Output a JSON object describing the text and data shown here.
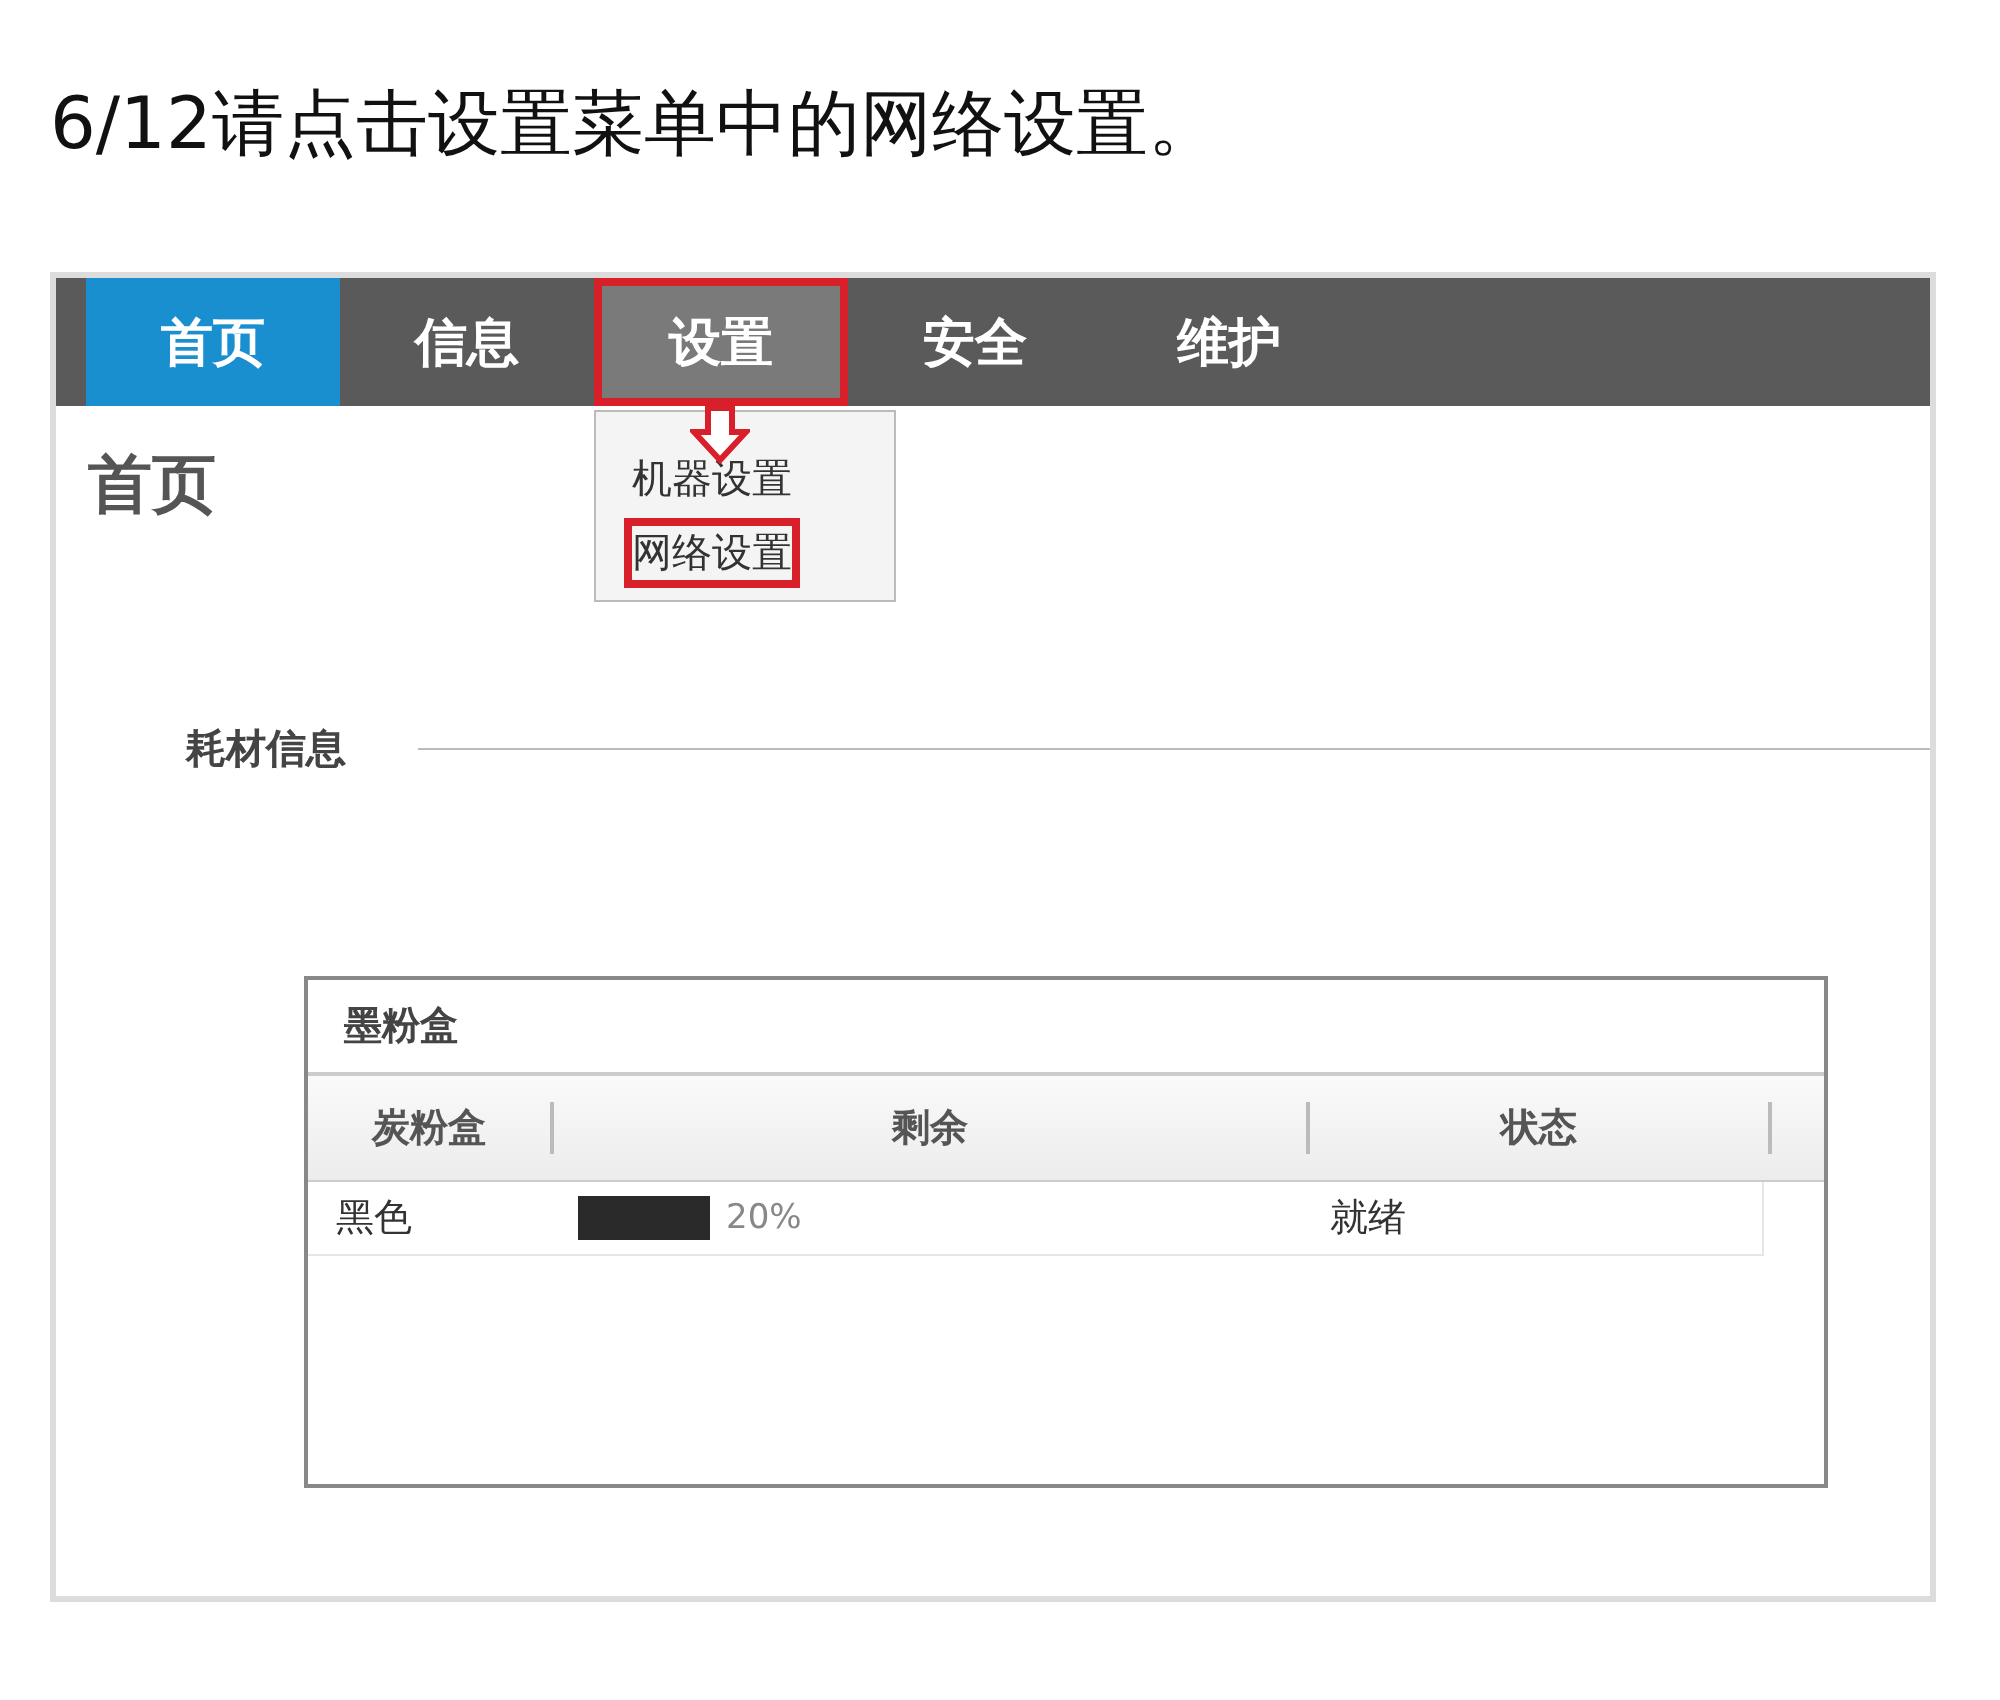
{
  "heading": "6/12请点击设置菜单中的网络设置。",
  "nav": {
    "tabs": [
      {
        "label": "首页",
        "selected": true,
        "open": false,
        "highlighted": false
      },
      {
        "label": "信息",
        "selected": false,
        "open": false,
        "highlighted": false
      },
      {
        "label": "设置",
        "selected": false,
        "open": true,
        "highlighted": true
      },
      {
        "label": "安全",
        "selected": false,
        "open": false,
        "highlighted": false
      },
      {
        "label": "维护",
        "selected": false,
        "open": false,
        "highlighted": false
      }
    ]
  },
  "dropdown": {
    "items": [
      {
        "label": "机器设置",
        "highlighted": false
      },
      {
        "label": "网络设置",
        "highlighted": true
      }
    ]
  },
  "page_title": "首页",
  "section_title": "耗材信息",
  "panel": {
    "title": "墨粉盒",
    "columns": [
      "炭粉盒",
      "剩余",
      "状态"
    ],
    "rows": [
      {
        "toner": "黑色",
        "level": 0.2,
        "reading": "20%",
        "status": "就绪"
      }
    ]
  }
}
